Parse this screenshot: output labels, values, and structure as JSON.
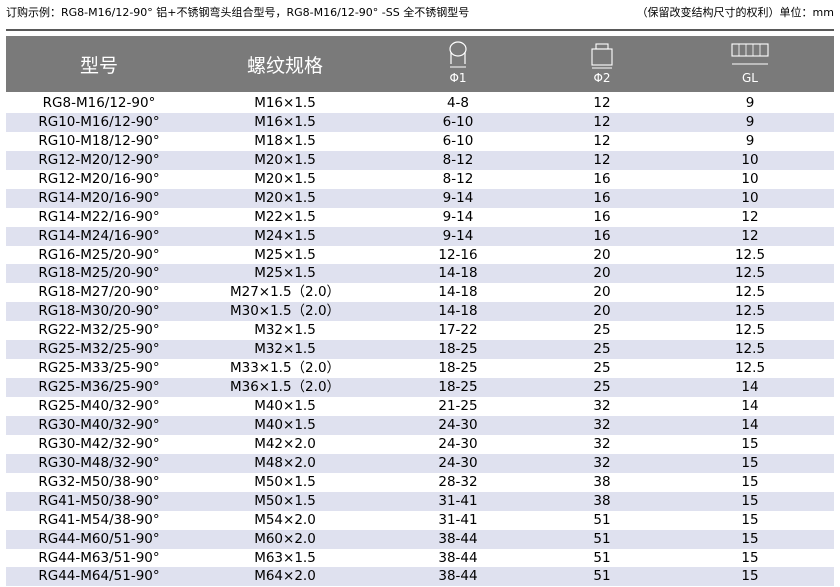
{
  "caption": {
    "left": "订购示例：RG8-M16/12-90°  铝+不锈钢弯头组合型号，RG8-M16/12-90° -SS 全不锈钢型号",
    "right": "（保留改变结构尺寸的权利）单位：mm"
  },
  "header": {
    "col1": "型号",
    "col2": "螺纹规格",
    "col3": "Φ1",
    "col4": "Φ2",
    "col5": "GL"
  },
  "rows": [
    [
      "RG8-M16/12-90°",
      "M16×1.5",
      "4-8",
      "12",
      "9"
    ],
    [
      "RG10-M16/12-90°",
      "M16×1.5",
      "6-10",
      "12",
      "9"
    ],
    [
      "RG10-M18/12-90°",
      "M18×1.5",
      "6-10",
      "12",
      "9"
    ],
    [
      "RG12-M20/12-90°",
      "M20×1.5",
      "8-12",
      "12",
      "10"
    ],
    [
      "RG12-M20/16-90°",
      "M20×1.5",
      "8-12",
      "16",
      "10"
    ],
    [
      "RG14-M20/16-90°",
      "M20×1.5",
      "9-14",
      "16",
      "10"
    ],
    [
      "RG14-M22/16-90°",
      "M22×1.5",
      "9-14",
      "16",
      "12"
    ],
    [
      "RG14-M24/16-90°",
      "M24×1.5",
      "9-14",
      "16",
      "12"
    ],
    [
      "RG16-M25/20-90°",
      "M25×1.5",
      "12-16",
      "20",
      "12.5"
    ],
    [
      "RG18-M25/20-90°",
      "M25×1.5",
      "14-18",
      "20",
      "12.5"
    ],
    [
      "RG18-M27/20-90°",
      "M27×1.5（2.0）",
      "14-18",
      "20",
      "12.5"
    ],
    [
      "RG18-M30/20-90°",
      "M30×1.5（2.0）",
      "14-18",
      "20",
      "12.5"
    ],
    [
      "RG22-M32/25-90°",
      "M32×1.5",
      "17-22",
      "25",
      "12.5"
    ],
    [
      "RG25-M32/25-90°",
      "M32×1.5",
      "18-25",
      "25",
      "12.5"
    ],
    [
      "RG25-M33/25-90°",
      "M33×1.5（2.0）",
      "18-25",
      "25",
      "12.5"
    ],
    [
      "RG25-M36/25-90°",
      "M36×1.5（2.0）",
      "18-25",
      "25",
      "14"
    ],
    [
      "RG25-M40/32-90°",
      "M40×1.5",
      "21-25",
      "32",
      "14"
    ],
    [
      "RG30-M40/32-90°",
      "M40×1.5",
      "24-30",
      "32",
      "14"
    ],
    [
      "RG30-M42/32-90°",
      "M42×2.0",
      "24-30",
      "32",
      "15"
    ],
    [
      "RG30-M48/32-90°",
      "M48×2.0",
      "24-30",
      "32",
      "15"
    ],
    [
      "RG32-M50/38-90°",
      "M50×1.5",
      "28-32",
      "38",
      "15"
    ],
    [
      "RG41-M50/38-90°",
      "M50×1.5",
      "31-41",
      "38",
      "15"
    ],
    [
      "RG41-M54/38-90°",
      "M54×2.0",
      "31-41",
      "51",
      "15"
    ],
    [
      "RG44-M60/51-90°",
      "M60×2.0",
      "38-44",
      "51",
      "15"
    ],
    [
      "RG44-M63/51-90°",
      "M63×1.5",
      "38-44",
      "51",
      "15"
    ],
    [
      "RG44-M64/51-90°",
      "M64×2.0",
      "38-44",
      "51",
      "15"
    ]
  ]
}
